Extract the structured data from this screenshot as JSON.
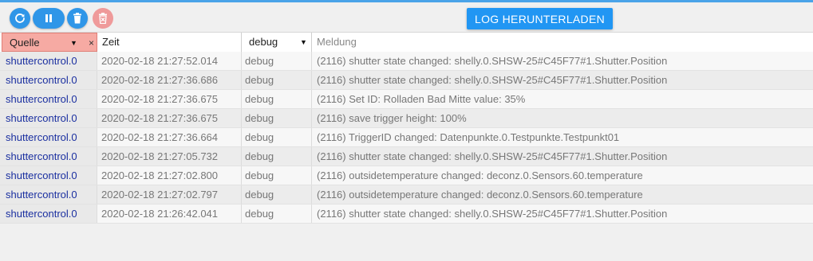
{
  "toolbar": {
    "refresh_icon": "refresh-icon",
    "pause_icon": "pause-icon",
    "delete_icon": "trash-icon",
    "clear_icon": "trash-x-icon",
    "download_label": "LOG HERUNTERLADEN",
    "accent": "#2196f3",
    "disabled_color": "#ef9a9a"
  },
  "table": {
    "columns": {
      "source": "Quelle",
      "source_clear": "×",
      "time": "Zeit",
      "severity": "debug",
      "message": "Meldung"
    },
    "filter_highlight_color": "#f6aaa3",
    "rows": [
      {
        "source": "shuttercontrol.0",
        "time": "2020-02-18 21:27:52.014",
        "severity": "debug",
        "message": "(2116) shutter state changed: shelly.0.SHSW-25#C45F77#1.Shutter.Position"
      },
      {
        "source": "shuttercontrol.0",
        "time": "2020-02-18 21:27:36.686",
        "severity": "debug",
        "message": "(2116) shutter state changed: shelly.0.SHSW-25#C45F77#1.Shutter.Position"
      },
      {
        "source": "shuttercontrol.0",
        "time": "2020-02-18 21:27:36.675",
        "severity": "debug",
        "message": "(2116) Set ID: Rolladen Bad Mitte value: 35%"
      },
      {
        "source": "shuttercontrol.0",
        "time": "2020-02-18 21:27:36.675",
        "severity": "debug",
        "message": "(2116) save trigger height: 100%"
      },
      {
        "source": "shuttercontrol.0",
        "time": "2020-02-18 21:27:36.664",
        "severity": "debug",
        "message": "(2116) TriggerID changed: Datenpunkte.0.Testpunkte.Testpunkt01"
      },
      {
        "source": "shuttercontrol.0",
        "time": "2020-02-18 21:27:05.732",
        "severity": "debug",
        "message": "(2116) shutter state changed: shelly.0.SHSW-25#C45F77#1.Shutter.Position"
      },
      {
        "source": "shuttercontrol.0",
        "time": "2020-02-18 21:27:02.800",
        "severity": "debug",
        "message": "(2116) outsidetemperature changed: deconz.0.Sensors.60.temperature"
      },
      {
        "source": "shuttercontrol.0",
        "time": "2020-02-18 21:27:02.797",
        "severity": "debug",
        "message": "(2116) outsidetemperature changed: deconz.0.Sensors.60.temperature"
      },
      {
        "source": "shuttercontrol.0",
        "time": "2020-02-18 21:26:42.041",
        "severity": "debug",
        "message": "(2116) shutter state changed: shelly.0.SHSW-25#C45F77#1.Shutter.Position"
      }
    ]
  }
}
